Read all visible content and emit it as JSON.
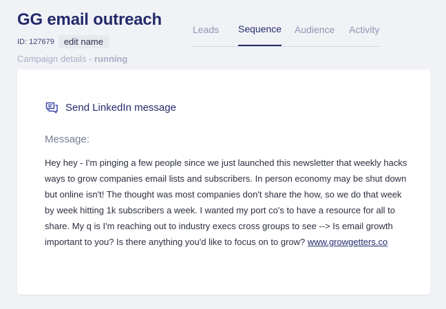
{
  "campaign": {
    "title": "GG email outreach",
    "id_label": "ID: 127679",
    "edit_label": "edit name",
    "details_label": "Campaign details - ",
    "status": "running"
  },
  "tabs": [
    {
      "label": "Leads",
      "active": false
    },
    {
      "label": "Sequence",
      "active": true
    },
    {
      "label": "Audience",
      "active": false
    },
    {
      "label": "Activity",
      "active": false
    }
  ],
  "step": {
    "icon": "linkedin-message-icon",
    "title": "Send LinkedIn message",
    "message_label": "Message:",
    "message_text": "Hey hey - I'm pinging a few people since we just launched this newsletter that weekly hacks ways to grow companies email lists and subscribers. In person economy may be shut down but online isn't! The thought was most companies don't share the how, so we do that week by week hitting 1k subscribers a week. I wanted my port co's to have a resource for all to share. My q is I'm reaching out to industry execs cross groups to see --> Is email growth important to you? Is there anything you'd like to focus on to grow?",
    "message_link": "www.growgetters.co"
  },
  "colors": {
    "primary": "#232a6b",
    "muted": "#a9aec4",
    "background": "#f1f2f6"
  }
}
